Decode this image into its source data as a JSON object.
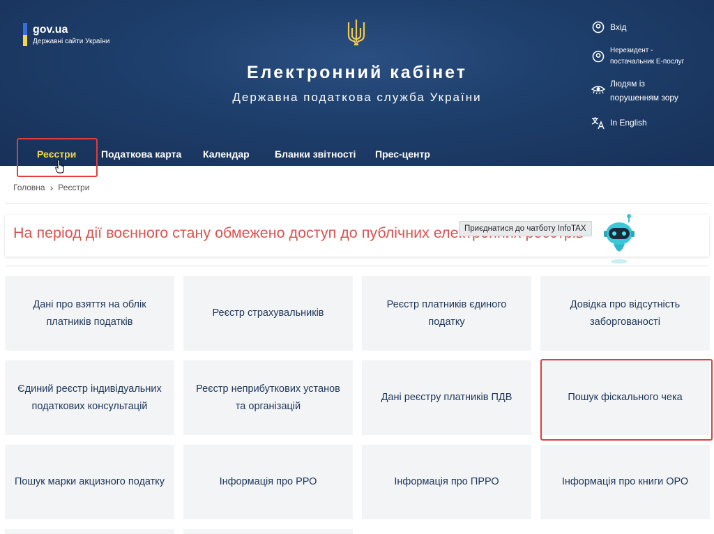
{
  "header": {
    "logo": {
      "name": "gov.ua",
      "subtitle": "Державні сайти України"
    },
    "title": "Електронний кабінет",
    "subtitle": "Державна податкова служба України",
    "links": {
      "login": "Вхід",
      "nonresident_line1": "Нерезидент -",
      "nonresident_line2": "постачальник Е-послуг",
      "vision_line1": "Людям із",
      "vision_line2": "порушенням зору",
      "english": "In English"
    }
  },
  "nav": {
    "items": [
      "Реєстри",
      "Податкова карта",
      "Календар",
      "Бланки звітності",
      "Прес-центр"
    ],
    "active": "Реєстри"
  },
  "breadcrumb": {
    "home": "Головна",
    "current": "Реєстри"
  },
  "alert": {
    "text": "На період дії воєнного стану обмежено доступ до публічних електронних реєстрів"
  },
  "chatbot": {
    "tooltip": "Приєднатися до чатботу InfoTAX"
  },
  "cards": [
    {
      "line1": "Дані про взяття на облік",
      "line2": "платників податків"
    },
    {
      "line1": "Реєстр страхувальників",
      "line2": ""
    },
    {
      "line1": "Реєстр платників єдиного",
      "line2": "податку"
    },
    {
      "line1": "Довідка про відсутність",
      "line2": "заборгованості"
    },
    {
      "line1": "Єдиний реєстр індивідуальних",
      "line2": "податкових консультацій"
    },
    {
      "line1": "Реєстр неприбуткових установ",
      "line2": "та організацій"
    },
    {
      "line1": "Дані реєстру платників ПДВ",
      "line2": ""
    },
    {
      "line1": "Пошук фіскального чека",
      "line2": ""
    },
    {
      "line1": "Пошук марки акцизного податку",
      "line2": ""
    },
    {
      "line1": "Інформація про РРО",
      "line2": ""
    },
    {
      "line1": "Інформація про ПРРО",
      "line2": ""
    },
    {
      "line1": "Інформація про книги ОРО",
      "line2": ""
    }
  ],
  "colors": {
    "header_bg": "#1e3f6c",
    "nav_active": "#f6d648",
    "alert_text": "#d9534f",
    "card_bg": "#f3f4f6",
    "highlight": "#e23c3c"
  }
}
